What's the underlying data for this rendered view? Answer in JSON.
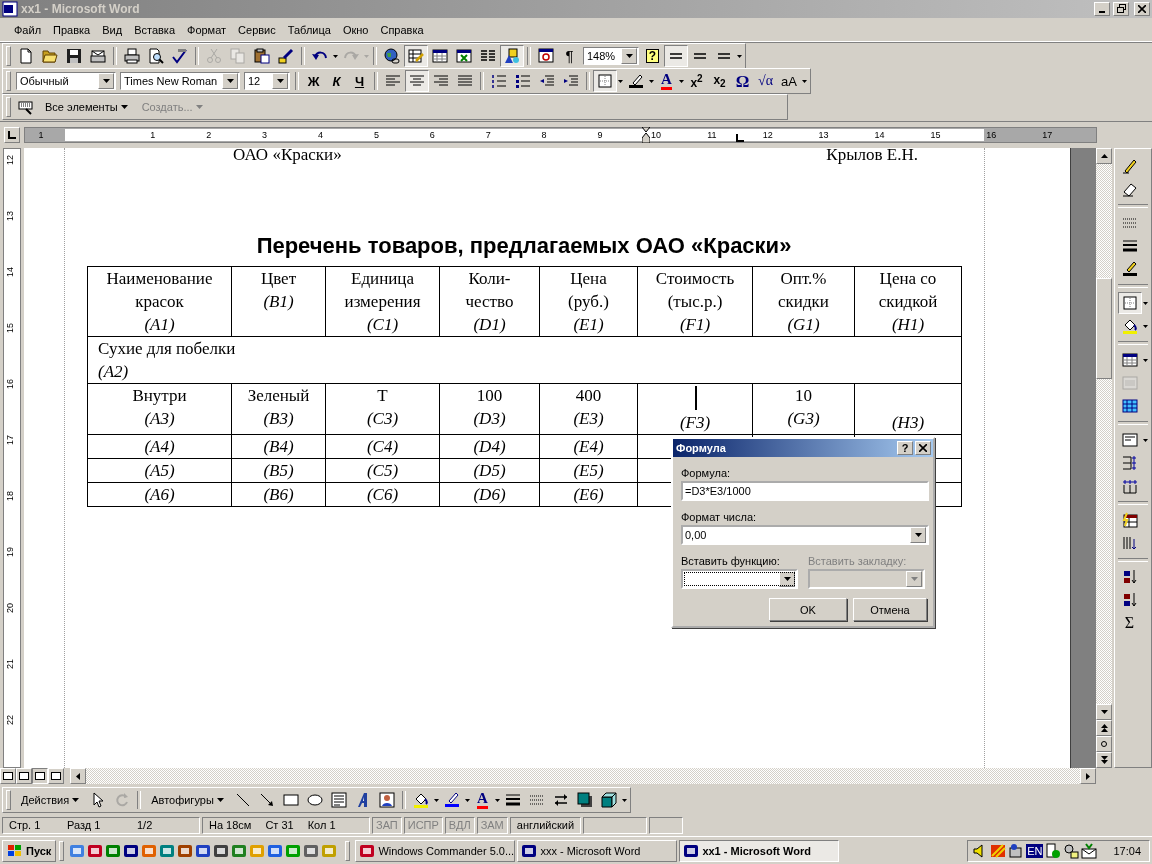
{
  "window": {
    "title": "xx1 - Microsoft Word"
  },
  "menu": [
    {
      "label": "Файл"
    },
    {
      "label": "Правка"
    },
    {
      "label": "Вид"
    },
    {
      "label": "Вставка"
    },
    {
      "label": "Формат"
    },
    {
      "label": "Сервис"
    },
    {
      "label": "Таблица"
    },
    {
      "label": "Окно"
    },
    {
      "label": "Справка"
    }
  ],
  "standard_toolbar": [
    {
      "kind": "new",
      "pressed": false,
      "disabled": false
    },
    {
      "kind": "open",
      "pressed": false,
      "disabled": false
    },
    {
      "kind": "save",
      "pressed": false,
      "disabled": false
    },
    {
      "kind": "email",
      "pressed": false,
      "disabled": false
    },
    {
      "kind": "separator"
    },
    {
      "kind": "print",
      "pressed": false,
      "disabled": false
    },
    {
      "kind": "preview",
      "pressed": false,
      "disabled": false
    },
    {
      "kind": "spelling",
      "pressed": false,
      "disabled": false
    },
    {
      "kind": "separator"
    },
    {
      "kind": "cut",
      "pressed": false,
      "disabled": true
    },
    {
      "kind": "copy",
      "pressed": false,
      "disabled": true
    },
    {
      "kind": "paste",
      "pressed": false,
      "disabled": false
    },
    {
      "kind": "painter",
      "pressed": false,
      "disabled": false
    },
    {
      "kind": "separator"
    },
    {
      "kind": "undo",
      "pressed": false,
      "disabled": false
    },
    {
      "kind": "caret",
      "disabled": false
    },
    {
      "kind": "redo",
      "pressed": false,
      "disabled": true
    },
    {
      "kind": "caret",
      "disabled": true
    },
    {
      "kind": "separator"
    },
    {
      "kind": "hyperlink",
      "pressed": false,
      "disabled": false
    },
    {
      "kind": "tables",
      "pressed": true,
      "disabled": false
    },
    {
      "kind": "insert_table",
      "pressed": false,
      "disabled": false
    },
    {
      "kind": "insert_sheet",
      "pressed": false,
      "disabled": false
    },
    {
      "kind": "columns",
      "pressed": false,
      "disabled": false
    },
    {
      "kind": "drawing",
      "pressed": true,
      "disabled": false
    },
    {
      "kind": "separator"
    },
    {
      "kind": "docmap",
      "pressed": false,
      "disabled": false
    },
    {
      "kind": "pilcrow",
      "label": "¶",
      "pressed": false,
      "disabled": false
    },
    {
      "kind": "combo",
      "value": "148%"
    },
    {
      "kind": "help",
      "label": "?",
      "pressed": false,
      "disabled": false
    },
    {
      "kind": "double_line",
      "pressed": true,
      "disabled": false
    },
    {
      "kind": "double_line",
      "pressed": false,
      "disabled": false
    },
    {
      "kind": "double_line",
      "pressed": false,
      "disabled": false
    },
    {
      "kind": "caret",
      "disabled": false
    }
  ],
  "formatting_toolbar": [
    {
      "kind": "combo",
      "value": "Обычный"
    },
    {
      "kind": "combo",
      "value": "Times New Roman"
    },
    {
      "kind": "combo",
      "value": "12"
    },
    {
      "kind": "separator"
    },
    {
      "kind": "bold",
      "label": "Ж",
      "pressed": false,
      "disabled": false
    },
    {
      "kind": "italic",
      "label": "К",
      "pressed": false,
      "disabled": false
    },
    {
      "kind": "underline",
      "label": "Ч",
      "pressed": false,
      "disabled": false
    },
    {
      "kind": "separator"
    },
    {
      "kind": "align_left",
      "pressed": false,
      "disabled": false
    },
    {
      "kind": "align_center",
      "pressed": true,
      "disabled": false
    },
    {
      "kind": "align_right",
      "pressed": false,
      "disabled": false
    },
    {
      "kind": "justify",
      "pressed": false,
      "disabled": false
    },
    {
      "kind": "separator"
    },
    {
      "kind": "numbering",
      "pressed": false,
      "disabled": false
    },
    {
      "kind": "bullets",
      "pressed": false,
      "disabled": false
    },
    {
      "kind": "outdent",
      "pressed": false,
      "disabled": false
    },
    {
      "kind": "indent",
      "pressed": false,
      "disabled": false
    },
    {
      "kind": "separator"
    },
    {
      "kind": "border",
      "pressed": true,
      "disabled": false
    },
    {
      "kind": "caret",
      "disabled": false
    },
    {
      "kind": "highlight",
      "pressed": false,
      "disabled": false
    },
    {
      "kind": "caret",
      "disabled": false
    },
    {
      "kind": "font_color",
      "label": "A",
      "pressed": false,
      "disabled": false
    },
    {
      "kind": "caret",
      "disabled": false
    },
    {
      "kind": "superscript",
      "label": "x$^{2}$",
      "pressed": false,
      "disabled": false
    },
    {
      "kind": "subscript",
      "label": "x$_{2}$",
      "pressed": false,
      "disabled": false
    },
    {
      "kind": "symbol",
      "label": "Ω",
      "pressed": false,
      "disabled": false
    },
    {
      "kind": "equation",
      "label": "√α",
      "pressed": false,
      "disabled": false
    },
    {
      "kind": "change_case",
      "label": "аА",
      "pressed": false,
      "disabled": false
    },
    {
      "kind": "caret",
      "disabled": false
    }
  ],
  "shortcut_toolbar": [
    {
      "kind": "keyboard",
      "pressed": false,
      "disabled": false
    },
    {
      "kind": "menu",
      "label": "Все элементы",
      "pressed": false,
      "disabled": false
    },
    {
      "kind": "menu",
      "label": "Создать...",
      "pressed": false,
      "disabled": true
    }
  ],
  "ruler": {
    "marks": [
      "1",
      "1",
      "2",
      "3",
      "4",
      "5",
      "6",
      "7",
      "8",
      "9",
      "10",
      "11",
      "12",
      "13",
      "14",
      "15",
      "16",
      "17"
    ]
  },
  "vertical_ruler": {
    "marks": [
      "12",
      "13",
      "14",
      "15",
      "16",
      "17",
      "18",
      "19",
      "20",
      "21",
      "22"
    ]
  },
  "document": {
    "top_lines": [
      "ОАО «Краски»",
      "Крылов Е.Н."
    ],
    "title": "Перечень товаров, предлагаемых ОАО  «Краски»",
    "table": {
      "header": [
        {
          "lines": [
            "Наименование",
            "красок"
          ],
          "ref": "(A1)"
        },
        {
          "lines": [
            "Цвет"
          ],
          "ref": "(B1)"
        },
        {
          "lines": [
            "Единица",
            "измерения"
          ],
          "ref": "(C1)"
        },
        {
          "lines": [
            "Коли-",
            "чество"
          ],
          "ref": "(D1)"
        },
        {
          "lines": [
            "Цена",
            "(руб.)"
          ],
          "ref": "(E1)"
        },
        {
          "lines": [
            "Стоимость",
            "(тыс.р.)"
          ],
          "ref": "(F1)"
        },
        {
          "lines": [
            "Опт.%",
            "скидки"
          ],
          "ref": "(G1)"
        },
        {
          "lines": [
            "Цена со",
            "скидкой"
          ],
          "ref": "(H1)"
        }
      ],
      "section": {
        "text": "Сухие для побелки",
        "ref": "(A2)"
      },
      "rows": [
        [
          {
            "text": "Внутри",
            "ref": "(A3)",
            "text_cursor": false
          },
          {
            "text": "Зеленый",
            "ref": "(B3)",
            "text_cursor": false
          },
          {
            "text": "Т",
            "ref": "(C3)",
            "text_cursor": false
          },
          {
            "text": "100",
            "ref": "(D3)",
            "text_cursor": false
          },
          {
            "text": "400",
            "ref": "(E3)",
            "text_cursor": false
          },
          {
            "ref": "(F3)",
            "text_cursor": true
          },
          {
            "text": "10",
            "ref": "(G3)",
            "text_cursor": false
          },
          {
            "ref": "(H3)",
            "text_cursor": false
          }
        ],
        [
          {
            "ref": "(A4)"
          },
          {
            "ref": "(B4)"
          },
          {
            "ref": "(C4)"
          },
          {
            "ref": "(D4)"
          },
          {
            "ref": "(E4)"
          },
          {},
          {},
          {}
        ],
        [
          {
            "ref": "(A5)"
          },
          {
            "ref": "(B5)"
          },
          {
            "ref": "(C5)"
          },
          {
            "ref": "(D5)"
          },
          {
            "ref": "(E5)"
          },
          {},
          {},
          {}
        ],
        [
          {
            "ref": "(A6)"
          },
          {
            "ref": "(B6)"
          },
          {
            "ref": "(C6)"
          },
          {
            "ref": "(D6)"
          },
          {
            "ref": "(E6)"
          },
          {},
          {},
          {}
        ]
      ]
    }
  },
  "tables_toolbar": [
    {
      "kind": "pencil",
      "pressed": false,
      "disabled": false
    },
    {
      "kind": "eraser",
      "pressed": false,
      "disabled": false
    },
    {
      "kind": "separator"
    },
    {
      "kind": "line_style",
      "pressed": false,
      "disabled": false
    },
    {
      "kind": "line_weight",
      "pressed": false,
      "disabled": false
    },
    {
      "kind": "border_color",
      "pressed": false,
      "disabled": false
    },
    {
      "kind": "separator"
    },
    {
      "kind": "border",
      "pressed": true,
      "disabled": false
    },
    {
      "kind": "caret",
      "disabled": false
    },
    {
      "kind": "fill",
      "pressed": false,
      "disabled": false
    },
    {
      "kind": "caret",
      "disabled": false
    },
    {
      "kind": "separator"
    },
    {
      "kind": "insert_table",
      "pressed": false,
      "disabled": false
    },
    {
      "kind": "caret",
      "disabled": false
    },
    {
      "kind": "merge",
      "pressed": false,
      "disabled": true
    },
    {
      "kind": "split",
      "pressed": false,
      "disabled": false
    },
    {
      "kind": "separator"
    },
    {
      "kind": "align_box",
      "pressed": false,
      "disabled": false
    },
    {
      "kind": "caret",
      "disabled": false
    },
    {
      "kind": "distribute_rows",
      "pressed": false,
      "disabled": false
    },
    {
      "kind": "distribute_cols",
      "pressed": false,
      "disabled": false
    },
    {
      "kind": "separator"
    },
    {
      "kind": "autoformat",
      "pressed": false,
      "disabled": false
    },
    {
      "kind": "text_direction",
      "pressed": false,
      "disabled": false
    },
    {
      "kind": "separator"
    },
    {
      "kind": "sort_asc",
      "pressed": false,
      "disabled": false
    },
    {
      "kind": "sort_desc",
      "pressed": false,
      "disabled": false
    },
    {
      "kind": "sum",
      "label": "Σ",
      "pressed": false,
      "disabled": false
    }
  ],
  "drawing_toolbar": [
    {
      "kind": "menu",
      "label": "Действия",
      "pressed": false,
      "disabled": false
    },
    {
      "kind": "pointer",
      "pressed": false,
      "disabled": false
    },
    {
      "kind": "rotate",
      "pressed": false,
      "disabled": true
    },
    {
      "kind": "separator"
    },
    {
      "kind": "menu",
      "label": "Автофигуры",
      "pressed": false,
      "disabled": false
    },
    {
      "kind": "line",
      "pressed": false,
      "disabled": false
    },
    {
      "kind": "arrow",
      "pressed": false,
      "disabled": false
    },
    {
      "kind": "rectangle",
      "pressed": false,
      "disabled": false
    },
    {
      "kind": "oval",
      "pressed": false,
      "disabled": false
    },
    {
      "kind": "textbox",
      "pressed": false,
      "disabled": false
    },
    {
      "kind": "wordart",
      "pressed": false,
      "disabled": false
    },
    {
      "kind": "clipart",
      "pressed": false,
      "disabled": false
    },
    {
      "kind": "separator"
    },
    {
      "kind": "fill",
      "pressed": false,
      "disabled": false
    },
    {
      "kind": "caret",
      "disabled": false
    },
    {
      "kind": "line_color",
      "pressed": false,
      "disabled": false
    },
    {
      "kind": "caret",
      "disabled": false
    },
    {
      "kind": "font_color",
      "label": "A",
      "pressed": false,
      "disabled": false
    },
    {
      "kind": "caret",
      "disabled": false
    },
    {
      "kind": "line_weight",
      "pressed": false,
      "disabled": false
    },
    {
      "kind": "line_style",
      "pressed": false,
      "disabled": false
    },
    {
      "kind": "arrows",
      "pressed": false,
      "disabled": false
    },
    {
      "kind": "shadow",
      "pressed": false,
      "disabled": false
    },
    {
      "kind": "cube",
      "pressed": false,
      "disabled": false
    },
    {
      "kind": "caret",
      "disabled": false
    }
  ],
  "status_bar": {
    "position": [
      "Стр. 1",
      "Разд 1",
      "1/2"
    ],
    "cursor": [
      "На 18см",
      "Ст 31",
      "Кол 1"
    ],
    "indicators": [
      {
        "label": "ЗАП",
        "on": false
      },
      {
        "label": "ИСПР",
        "on": false
      },
      {
        "label": "ВДЛ",
        "on": false
      },
      {
        "label": "ЗАМ",
        "on": false
      }
    ],
    "language": "английский"
  },
  "dialog": {
    "title": "Формула",
    "help": "?",
    "formula_label": "Формула:",
    "formula_value": "=D3*E3/1000",
    "format_label": "Формат числа:",
    "format_value": "0,00",
    "function_label": "Вставить функцию:",
    "function_disabled": false,
    "bookmark_label": "Вставить закладку:",
    "bookmark_disabled": true,
    "buttons": [
      "OK",
      "Отмена"
    ]
  },
  "taskbar": {
    "start": "Пуск",
    "quick_launch": [
      {
        "kind": "sync"
      },
      {
        "kind": "floppy"
      },
      {
        "kind": "sheet"
      },
      {
        "kind": "word"
      },
      {
        "kind": "flame"
      },
      {
        "kind": "calc"
      },
      {
        "kind": "books"
      },
      {
        "kind": "binders"
      },
      {
        "kind": "monitor"
      },
      {
        "kind": "eye"
      },
      {
        "kind": "bolt"
      },
      {
        "kind": "browser"
      },
      {
        "kind": "flower"
      },
      {
        "kind": "docs"
      },
      {
        "kind": "notepad"
      }
    ],
    "tasks": [
      {
        "label": "Windows Commander 5.0...",
        "selected": false
      },
      {
        "label": "xxx - Microsoft Word",
        "selected": false
      },
      {
        "label": "xx1 - Microsoft Word",
        "selected": true
      }
    ],
    "tray": {
      "language": "EN",
      "time": "17:04"
    }
  }
}
